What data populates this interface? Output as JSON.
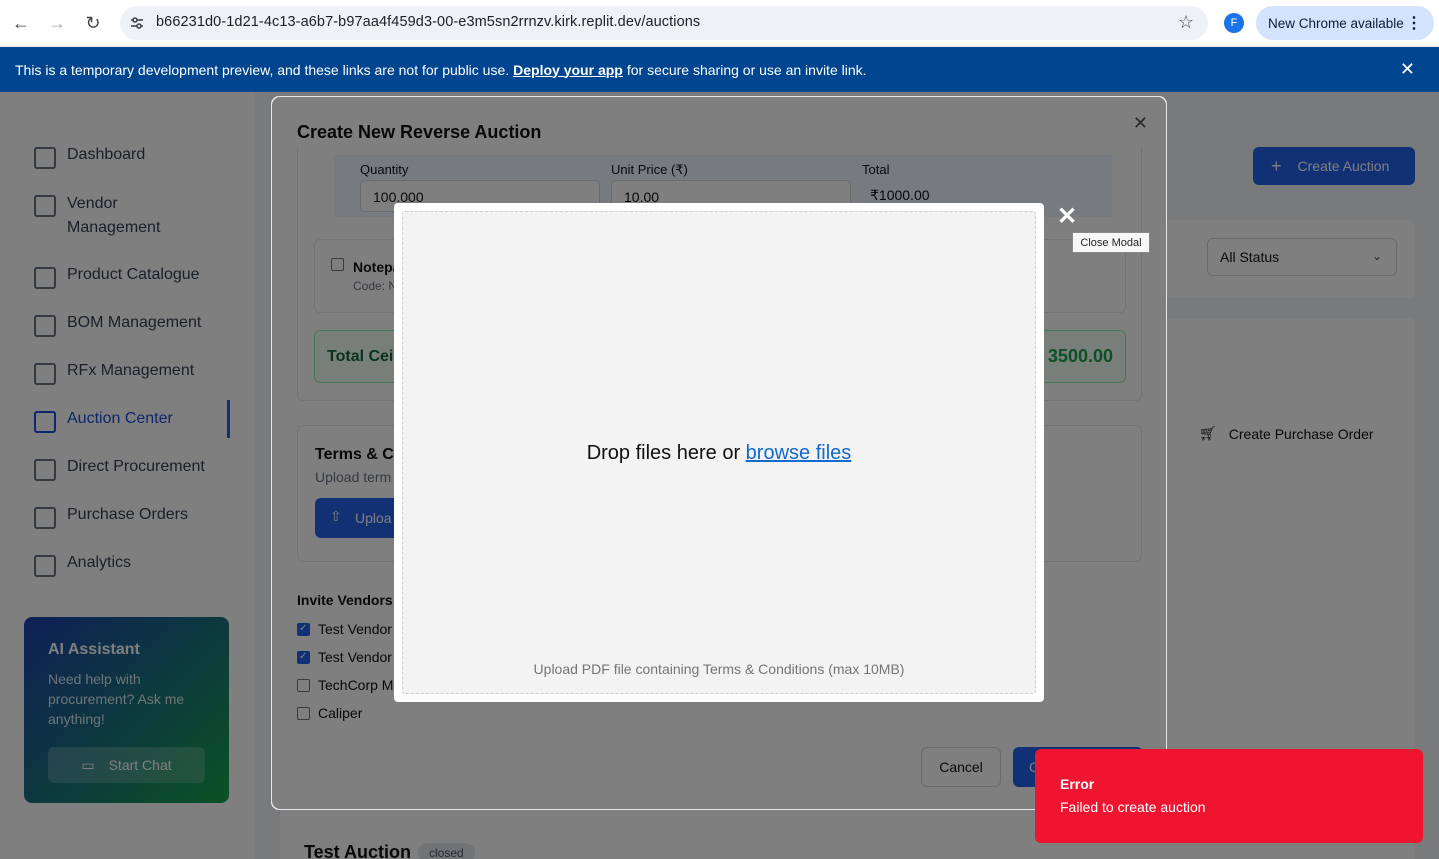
{
  "browser": {
    "url": "b66231d0-1d21-4c13-a6b7-b97aa4f459d3-00-e3m5sn2rrnzv.kirk.replit.dev/auctions",
    "profile_initial": "F",
    "update_label": "New Chrome available"
  },
  "banner": {
    "text_before": "This is a temporary development preview, and these links are not for public use.",
    "link": "Deploy your app",
    "text_after": "for secure sharing or use an invite link."
  },
  "sidebar": {
    "items": [
      {
        "label": "Dashboard"
      },
      {
        "label": "Vendor"
      },
      {
        "label": "Management"
      },
      {
        "label": "Product Catalogue"
      },
      {
        "label": "BOM Management"
      },
      {
        "label": "RFx Management"
      },
      {
        "label": "Auction Center"
      },
      {
        "label": "Direct Procurement"
      },
      {
        "label": "Purchase Orders"
      },
      {
        "label": "Analytics"
      }
    ],
    "ai": {
      "title": "AI Assistant",
      "description": "Need help with procurement? Ask me anything!",
      "button": "Start Chat"
    }
  },
  "main": {
    "create_button": "Create Auction",
    "status_filter": "All Status",
    "create_po": "Create Purchase Order",
    "auction_title": "Test Auction",
    "auction_status": "closed"
  },
  "dialog": {
    "title": "Create New Reverse Auction",
    "item": {
      "quantity_label": "Quantity",
      "quantity_value": "100.000",
      "unit_price_label": "Unit Price (₹)",
      "unit_price_value": "10.00",
      "total_label": "Total",
      "total_value": "₹1000.00"
    },
    "product": {
      "name": "Notepa",
      "code": "Code: N"
    },
    "ceiling": {
      "label": "Total Ceil",
      "value": "3500.00"
    },
    "terms": {
      "title": "Terms & Co",
      "subtitle": "Upload term",
      "upload_button": "Uploa"
    },
    "invite_title": "Invite Vendors",
    "vendors": [
      {
        "name": "Test Vendor",
        "checked": true
      },
      {
        "name": "Test Vendor",
        "checked": true
      },
      {
        "name": "TechCorp M",
        "checked": false
      },
      {
        "name": "Caliper",
        "checked": false
      }
    ],
    "cancel": "Cancel",
    "create": "C"
  },
  "uploader": {
    "drop_text": "Drop files here or",
    "browse": "browse files",
    "note": "Upload PDF file containing Terms & Conditions (max 10MB)",
    "close_tooltip": "Close Modal"
  },
  "toast": {
    "title": "Error",
    "description": "Failed to create auction",
    "color": "#ef1530"
  }
}
